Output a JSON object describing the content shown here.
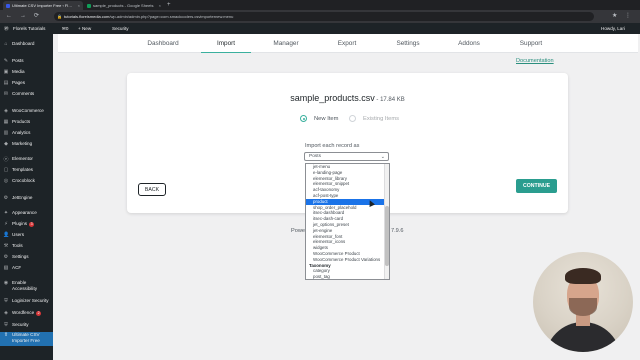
{
  "browser": {
    "tabs": [
      {
        "title": "Ultimate CSV Importer Free ‹ Fl…",
        "close": "×"
      },
      {
        "title": "sample_products - Google Sheets",
        "close": "×"
      }
    ],
    "new_tab": "+",
    "url_host": "tutorials.florelsmedia.com",
    "url_path": "/wp-admin/admin.php?page=com.smackcoders.csvimporternew.menu",
    "lock": "🔒",
    "back": "←",
    "forward": "→",
    "reload": "⟳",
    "extensions": "★ ⋮"
  },
  "adminbar": {
    "site_name": "Florels Tutorials",
    "comments": "0",
    "new": "+ New",
    "security": "Security",
    "greeting": "Howdy, Lari"
  },
  "sidebar": {
    "items": [
      {
        "label": "Dashboard",
        "icon": "⌂"
      },
      {
        "label": "Posts",
        "icon": "✎"
      },
      {
        "label": "Media",
        "icon": "▣"
      },
      {
        "label": "Pages",
        "icon": "▤"
      },
      {
        "label": "Comments",
        "icon": "✉"
      },
      {
        "label": "WooCommerce",
        "icon": "◈"
      },
      {
        "label": "Products",
        "icon": "▦"
      },
      {
        "label": "Analytics",
        "icon": "▥"
      },
      {
        "label": "Marketing",
        "icon": "◆"
      },
      {
        "label": "Elementor",
        "icon": "ⓔ"
      },
      {
        "label": "Templates",
        "icon": "▢"
      },
      {
        "label": "Crocoblock",
        "icon": "◎"
      },
      {
        "label": "JetEngine",
        "icon": "⚙"
      },
      {
        "label": "Appearance",
        "icon": "✦"
      },
      {
        "label": "Plugins",
        "icon": "⚡",
        "badge": "3"
      },
      {
        "label": "Users",
        "icon": "👤"
      },
      {
        "label": "Tools",
        "icon": "⚒"
      },
      {
        "label": "Settings",
        "icon": "⚙"
      },
      {
        "label": "ACF",
        "icon": "▧"
      },
      {
        "label": "Enable Accessibility",
        "icon": "◉"
      },
      {
        "label": "Loginizer Security",
        "icon": "⛨"
      },
      {
        "label": "Wordfence",
        "icon": "◈",
        "badge": "2"
      },
      {
        "label": "Security",
        "icon": "⛨"
      },
      {
        "label": "Ultimate CSV Importer Free",
        "icon": "⇪"
      }
    ]
  },
  "navtabs": [
    "Dashboard",
    "Import",
    "Manager",
    "Export",
    "Settings",
    "Addons",
    "Support"
  ],
  "documentation_link": "Documentation",
  "import_panel": {
    "filename": "sample_products.csv",
    "filesize": " - 17.84 KB",
    "radio_new": "New Item",
    "radio_existing": "Existing Items",
    "import_label": "Import each record as",
    "select_value": "Posts",
    "back_button": "BACK",
    "continue_button": "CONTINUE"
  },
  "footer": {
    "powered": "Powe",
    "version": "7.9.6"
  },
  "dropdown": {
    "items": [
      {
        "label": "jet-menu"
      },
      {
        "label": "e-landing-page"
      },
      {
        "label": "elementor_library"
      },
      {
        "label": "elementor_snippet"
      },
      {
        "label": "acf-taxonomy"
      },
      {
        "label": "acf-post-type"
      },
      {
        "label": "product",
        "selected": true
      },
      {
        "label": "shop_order_placehold"
      },
      {
        "label": "itsec-dashboard"
      },
      {
        "label": "itsec-dash-card"
      },
      {
        "label": "jet_options_preset"
      },
      {
        "label": "jet-engine"
      },
      {
        "label": "elementor_font"
      },
      {
        "label": "elementor_icons"
      },
      {
        "label": "widgets"
      },
      {
        "label": "WooCommerce Product"
      },
      {
        "label": "WooCommerce Product Variations"
      },
      {
        "label": "Taxonomy",
        "group": true
      },
      {
        "label": "category"
      },
      {
        "label": "post_tag"
      }
    ]
  },
  "colors": {
    "accent": "#2a9d8f",
    "wp_dark": "#1d2327",
    "selection": "#1a73e8"
  }
}
